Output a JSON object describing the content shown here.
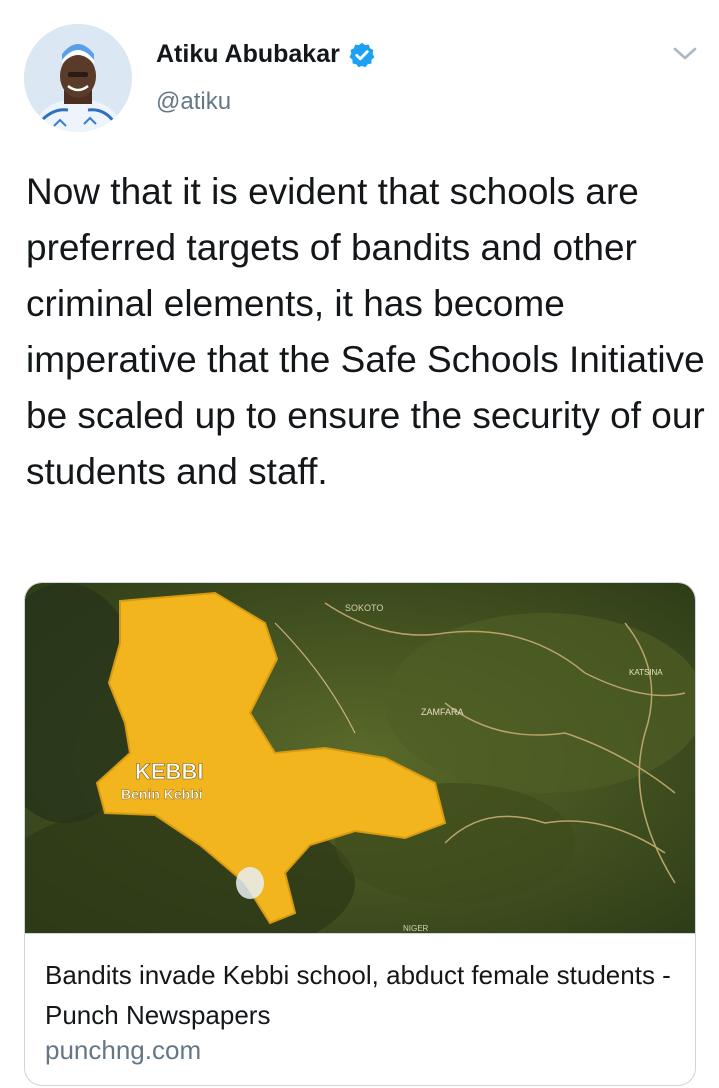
{
  "author": {
    "name": "Atiku Abubakar",
    "handle": "@atiku",
    "verified_icon": "verified-badge-icon"
  },
  "tweet": {
    "text": "Now that it is evident that schools are preferred targets of bandits and other criminal elements, it has become imperative that the Safe Schools Initiative be scaled up to ensure the security of our students and staff."
  },
  "card": {
    "title": "Bandits invade Kebbi school, abduct female students - Punch Newspapers",
    "domain": "punchng.com",
    "map_labels": {
      "kebbi": "KEBBI",
      "benin_kebbi": "Benin Kebbi",
      "sokoto": "SOKOTO",
      "zamfara": "ZAMFARA",
      "katsina": "KATSINA",
      "niger": "NIGER"
    }
  },
  "colors": {
    "accent": "#1da1f2",
    "secondary_text": "#657786",
    "border": "#ccd6dd",
    "kebbi_region": "#f2b51e"
  }
}
